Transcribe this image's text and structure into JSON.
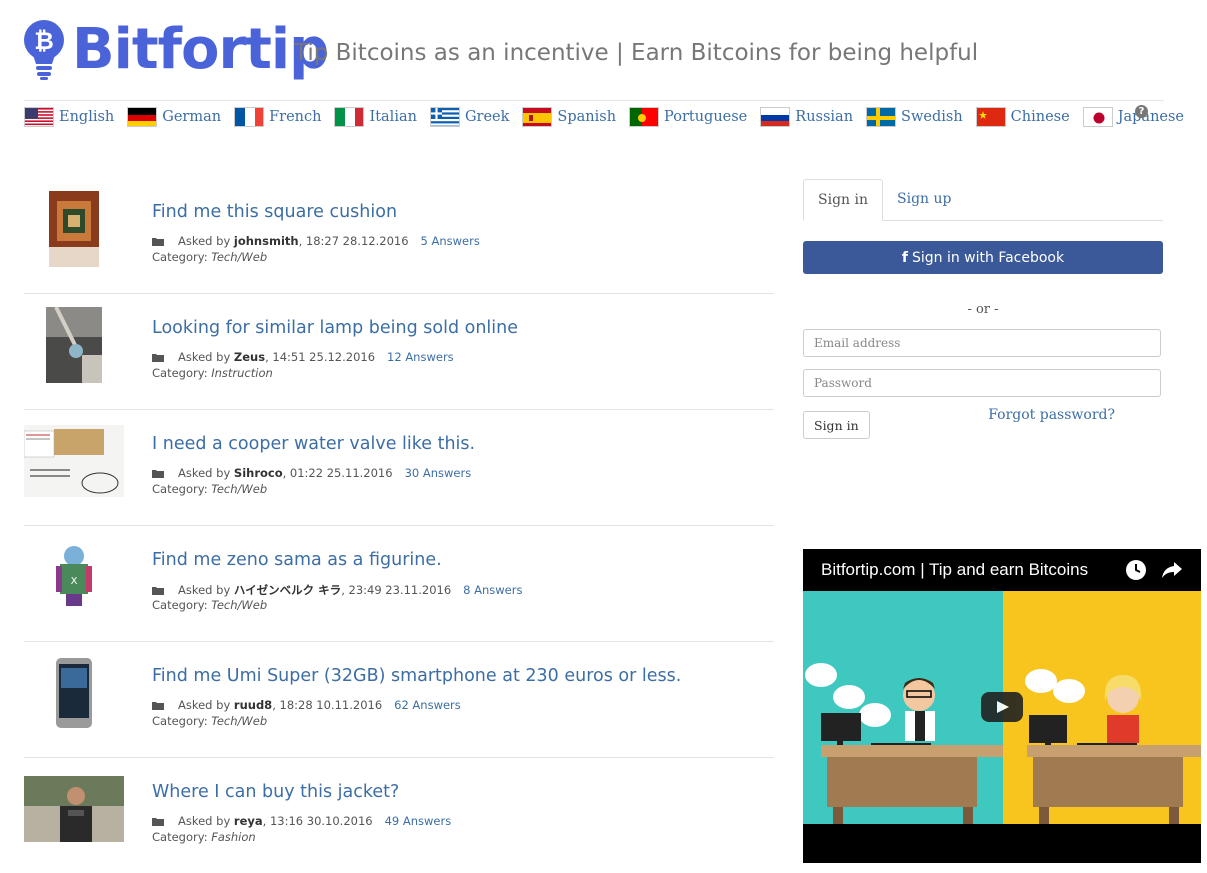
{
  "brand": {
    "name": "Bitfortip",
    "tagline": "Tip Bitcoins as an incentive |  Earn Bitcoins for being helpful"
  },
  "languages": [
    {
      "label": "English",
      "flag": "us-flag-icon"
    },
    {
      "label": "German",
      "flag": "de-flag-icon"
    },
    {
      "label": "French",
      "flag": "fr-flag-icon"
    },
    {
      "label": "Italian",
      "flag": "it-flag-icon"
    },
    {
      "label": "Greek",
      "flag": "gr-flag-icon"
    },
    {
      "label": "Spanish",
      "flag": "es-flag-icon"
    },
    {
      "label": "Portuguese",
      "flag": "pt-flag-icon"
    },
    {
      "label": "Russian",
      "flag": "ru-flag-icon"
    },
    {
      "label": "Swedish",
      "flag": "se-flag-icon"
    },
    {
      "label": "Chinese",
      "flag": "cn-flag-icon"
    },
    {
      "label": "Japanese",
      "flag": "jp-flag-icon"
    }
  ],
  "help": "?",
  "questions": [
    {
      "title": "Find me this square cushion",
      "asked_prefix": "Asked by",
      "user": "johnsmith",
      "time": ", 18:27 28.12.2016",
      "answers": "5 Answers",
      "category_prefix": "Category:",
      "category": "Tech/Web"
    },
    {
      "title": "Looking for similar lamp being sold online",
      "asked_prefix": "Asked by",
      "user": "Zeus",
      "time": ", 14:51 25.12.2016",
      "answers": "12 Answers",
      "category_prefix": "Category:",
      "category": "Instruction"
    },
    {
      "title": "I need a cooper water valve like this.",
      "asked_prefix": "Asked by",
      "user": "Sihroco",
      "time": ", 01:22 25.11.2016",
      "answers": "30 Answers",
      "category_prefix": "Category:",
      "category": "Tech/Web"
    },
    {
      "title": "Find me zeno sama as a figurine.",
      "asked_prefix": "Asked by",
      "user": "ハイゼンベルク キラ",
      "time": ", 23:49 23.11.2016",
      "answers": "8 Answers",
      "category_prefix": "Category:",
      "category": "Tech/Web"
    },
    {
      "title": "Find me Umi Super (32GB) smartphone at 230 euros or less.",
      "asked_prefix": "Asked by",
      "user": "ruud8",
      "time": ", 18:28 10.11.2016",
      "answers": "62 Answers",
      "category_prefix": "Category:",
      "category": "Tech/Web"
    },
    {
      "title": "Where I can buy this jacket?",
      "asked_prefix": "Asked by",
      "user": "reya",
      "time": ", 13:16 30.10.2016",
      "answers": "49 Answers",
      "category_prefix": "Category:",
      "category": "Fashion"
    }
  ],
  "auth": {
    "tab_signin": "Sign in",
    "tab_signup": "Sign up",
    "facebook_icon": "f",
    "facebook_label": "Sign in with Facebook",
    "or": "- or -",
    "email_placeholder": "Email address",
    "password_placeholder": "Password",
    "signin_button": "Sign in",
    "forgot": "Forgot password?"
  },
  "video": {
    "title": "Bitfortip.com | Tip and earn Bitcoins"
  },
  "colors": {
    "brand": "#4a63d8",
    "link": "#3c6ea5",
    "facebook": "#3b5998",
    "video_left": "#3fc8c0",
    "video_right": "#f7c51e"
  }
}
